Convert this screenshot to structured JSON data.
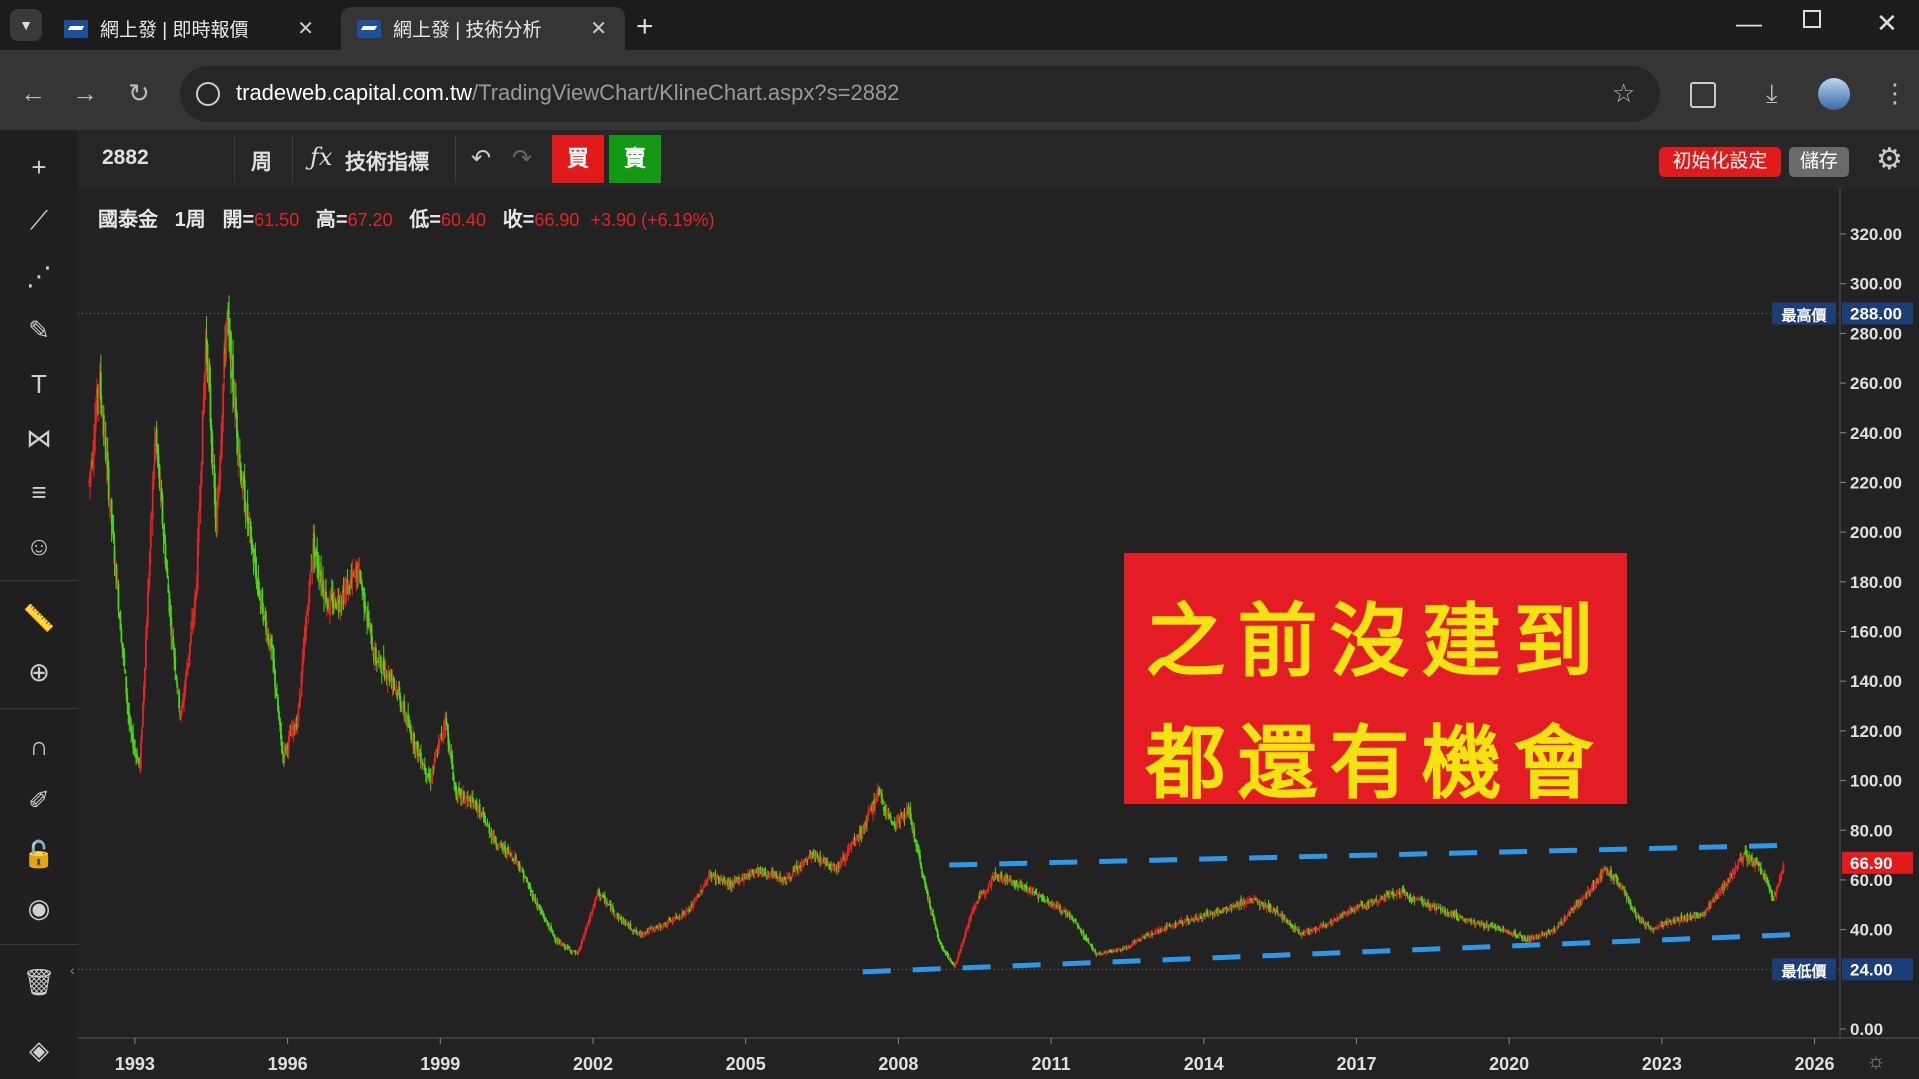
{
  "browser": {
    "tabs": [
      {
        "title": "網上發 | 即時報價",
        "active": false
      },
      {
        "title": "網上發 | 技術分析",
        "active": true
      }
    ],
    "url_host": "tradeweb.capital.com.tw",
    "url_path": "/TradingViewChart/KlineChart.aspx?s=2882"
  },
  "toolbar": {
    "symbol": "2882",
    "interval": "周",
    "indicators_label": "技術指標",
    "buy_label": "買",
    "sell_label": "賣",
    "reset_label": "初始化設定",
    "save_label": "儲存"
  },
  "legend": {
    "name": "國泰金",
    "interval": "1周",
    "open_label": "開=",
    "open": "61.50",
    "high_label": "高=",
    "high": "67.20",
    "low_label": "低=",
    "low": "60.40",
    "close_label": "收=",
    "close": "66.90",
    "change": "+3.90 (+6.19%)"
  },
  "overlay": {
    "line1": "之前沒建到",
    "line2": "都還有機會"
  },
  "chart_data": {
    "type": "candlestick",
    "x_ticks": [
      "1993",
      "1996",
      "1999",
      "2002",
      "2005",
      "2008",
      "2011",
      "2014",
      "2017",
      "2020",
      "2023",
      "2026"
    ],
    "y_ticks": [
      "320.00",
      "300.00",
      "280.00",
      "260.00",
      "240.00",
      "220.00",
      "200.00",
      "180.00",
      "160.00",
      "140.00",
      "120.00",
      "100.00",
      "80.00",
      "60.00",
      "40.00",
      "0.00"
    ],
    "ylim": [
      0,
      320
    ],
    "xlim": [
      1992,
      2026.5
    ],
    "max_label": "最高價",
    "max_value": "288.00",
    "min_label": "最低價",
    "min_value": "24.00",
    "last_value": "66.90",
    "colors": {
      "up": "#e32424",
      "down": "#4cd417",
      "trend": "#2f97e8",
      "last": "#e11b1b",
      "hl_box": "#1c3d78"
    },
    "price_path": [
      [
        1992.1,
        220
      ],
      [
        1992.3,
        262
      ],
      [
        1992.6,
        190
      ],
      [
        1992.9,
        120
      ],
      [
        1993.1,
        105
      ],
      [
        1993.4,
        240
      ],
      [
        1993.7,
        165
      ],
      [
        1993.9,
        125
      ],
      [
        1994.2,
        175
      ],
      [
        1994.4,
        280
      ],
      [
        1994.6,
        200
      ],
      [
        1994.8,
        288
      ],
      [
        1995.1,
        220
      ],
      [
        1995.4,
        180
      ],
      [
        1995.7,
        150
      ],
      [
        1995.9,
        110
      ],
      [
        1996.2,
        125
      ],
      [
        1996.5,
        195
      ],
      [
        1996.8,
        170
      ],
      [
        1997.1,
        175
      ],
      [
        1997.4,
        185
      ],
      [
        1997.7,
        150
      ],
      [
        1998.1,
        140
      ],
      [
        1998.4,
        120
      ],
      [
        1998.8,
        100
      ],
      [
        1999.1,
        125
      ],
      [
        1999.3,
        95
      ],
      [
        1999.7,
        90
      ],
      [
        2000.1,
        75
      ],
      [
        2000.5,
        68
      ],
      [
        2000.9,
        50
      ],
      [
        2001.3,
        35
      ],
      [
        2001.7,
        30
      ],
      [
        2002.1,
        55
      ],
      [
        2002.5,
        45
      ],
      [
        2002.9,
        38
      ],
      [
        2003.4,
        42
      ],
      [
        2003.9,
        48
      ],
      [
        2004.3,
        62
      ],
      [
        2004.7,
        58
      ],
      [
        2005.2,
        64
      ],
      [
        2005.8,
        60
      ],
      [
        2006.3,
        70
      ],
      [
        2006.8,
        65
      ],
      [
        2007.3,
        80
      ],
      [
        2007.6,
        95
      ],
      [
        2007.9,
        82
      ],
      [
        2008.2,
        88
      ],
      [
        2008.5,
        60
      ],
      [
        2008.8,
        35
      ],
      [
        2009.1,
        25
      ],
      [
        2009.5,
        50
      ],
      [
        2009.9,
        62
      ],
      [
        2010.4,
        58
      ],
      [
        2010.9,
        52
      ],
      [
        2011.4,
        45
      ],
      [
        2011.9,
        30
      ],
      [
        2012.4,
        32
      ],
      [
        2012.9,
        38
      ],
      [
        2013.4,
        42
      ],
      [
        2013.9,
        45
      ],
      [
        2014.4,
        48
      ],
      [
        2014.9,
        52
      ],
      [
        2015.4,
        48
      ],
      [
        2015.9,
        38
      ],
      [
        2016.4,
        42
      ],
      [
        2016.9,
        48
      ],
      [
        2017.4,
        52
      ],
      [
        2017.9,
        55
      ],
      [
        2018.4,
        50
      ],
      [
        2018.9,
        46
      ],
      [
        2019.4,
        42
      ],
      [
        2019.9,
        40
      ],
      [
        2020.4,
        36
      ],
      [
        2020.9,
        40
      ],
      [
        2021.4,
        52
      ],
      [
        2021.9,
        64
      ],
      [
        2022.2,
        58
      ],
      [
        2022.5,
        45
      ],
      [
        2022.8,
        40
      ],
      [
        2023.3,
        44
      ],
      [
        2023.8,
        46
      ],
      [
        2024.3,
        60
      ],
      [
        2024.6,
        70
      ],
      [
        2024.9,
        66
      ],
      [
        2025.2,
        52
      ],
      [
        2025.4,
        66.9
      ]
    ],
    "trendlines": [
      {
        "x1": 2009.0,
        "y1": 66,
        "x2": 2025.6,
        "y2": 74
      },
      {
        "x1": 2007.3,
        "y1": 23,
        "x2": 2025.6,
        "y2": 38
      }
    ]
  }
}
